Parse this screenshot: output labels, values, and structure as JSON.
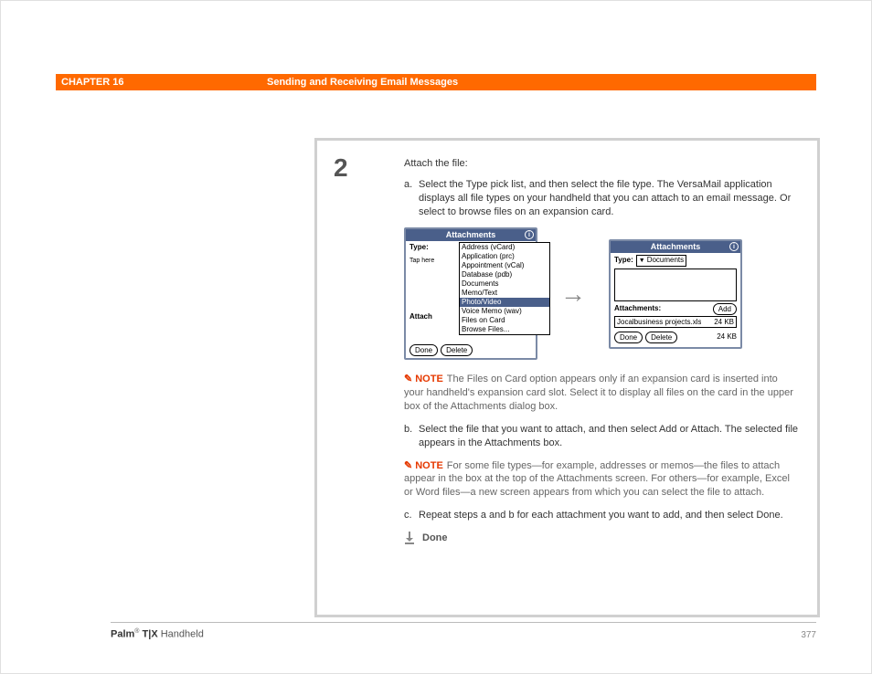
{
  "header": {
    "chapter": "CHAPTER 16",
    "title": "Sending and Receiving Email Messages"
  },
  "step": {
    "number": "2",
    "intro": "Attach the file:",
    "a_marker": "a.",
    "a_text": "Select the Type pick list, and then select the file type. The VersaMail application displays all file types on your handheld that you can attach to an email message. Or select to browse files on an expansion card.",
    "b_marker": "b.",
    "b_text": "Select the file that you want to attach, and then select Add or Attach. The selected file appears in the Attachments box.",
    "c_marker": "c.",
    "c_text": "Repeat steps a and b for each attachment you want to add, and then select Done."
  },
  "note1": {
    "label": "NOTE",
    "text": "The Files on Card option appears only if an expansion card is inserted into your handheld's expansion card slot. Select it to display all files on the card in the upper box of the Attachments dialog box."
  },
  "note2": {
    "label": "NOTE",
    "text": "For some file types—for example, addresses or memos—the files to attach appear in the box at the top of the Attachments screen. For others—for example, Excel or Word files—a new screen appears from which you can select the file to attach."
  },
  "done": "Done",
  "screen1": {
    "title": "Attachments",
    "info": "i",
    "type_label": "Type:",
    "taphere": "Tap here",
    "attach_label": "Attach",
    "list": [
      "Address (vCard)",
      "Application (prc)",
      "Appointment (vCal)",
      "Database (pdb)",
      "Documents",
      "Memo/Text",
      "Photo/Video",
      "Voice Memo (wav)",
      "Files on Card",
      "Browse Files..."
    ],
    "selected_index": 6,
    "done": "Done",
    "delete": "Delete"
  },
  "screen2": {
    "title": "Attachments",
    "info": "i",
    "type_label": "Type:",
    "type_value": "Documents",
    "attach_label": "Attachments:",
    "add": "Add",
    "file_name": "Jocalbusiness projects.xls",
    "file_size": "24 KB",
    "done": "Done",
    "delete": "Delete",
    "total": "24 KB"
  },
  "footer": {
    "brand": "Palm",
    "reg": "®",
    "model": " T|X",
    "rest": " Handheld",
    "page": "377"
  }
}
